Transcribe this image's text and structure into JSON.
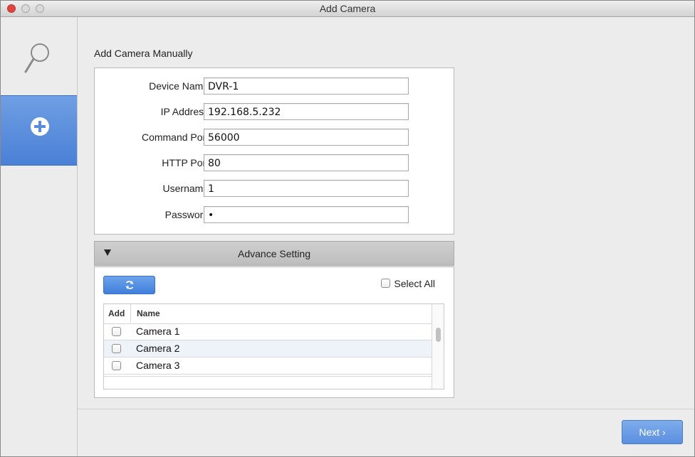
{
  "window": {
    "title": "Add Camera"
  },
  "sidebar": {
    "items": [
      {
        "name": "search",
        "icon": "search-icon"
      },
      {
        "name": "add",
        "icon": "plus-circle-icon",
        "selected": true
      }
    ]
  },
  "main": {
    "heading": "Add Camera Manually",
    "form": {
      "device_name_label": "Device Name:",
      "device_name_value": "DVR-1",
      "ip_label": "IP Address:",
      "ip_value": "192.168.5.232",
      "command_port_label": "Command Port:",
      "command_port_value": "56000",
      "http_port_label": "HTTP Port:",
      "http_port_value": "80",
      "username_label": "Username:",
      "username_value": "1",
      "password_label": "Password:",
      "password_value": "•"
    },
    "advance": {
      "label": "Advance Setting",
      "refresh_icon": "refresh-icon",
      "select_all_label": "Select All",
      "columns": [
        "Add",
        "Name"
      ],
      "cameras": [
        {
          "name": "Camera 1",
          "checked": false
        },
        {
          "name": "Camera 2",
          "checked": false
        },
        {
          "name": "Camera 3",
          "checked": false
        }
      ]
    },
    "next_label": "Next ›"
  },
  "colors": {
    "accent": "#4a80d6",
    "close": "#e0443e"
  }
}
